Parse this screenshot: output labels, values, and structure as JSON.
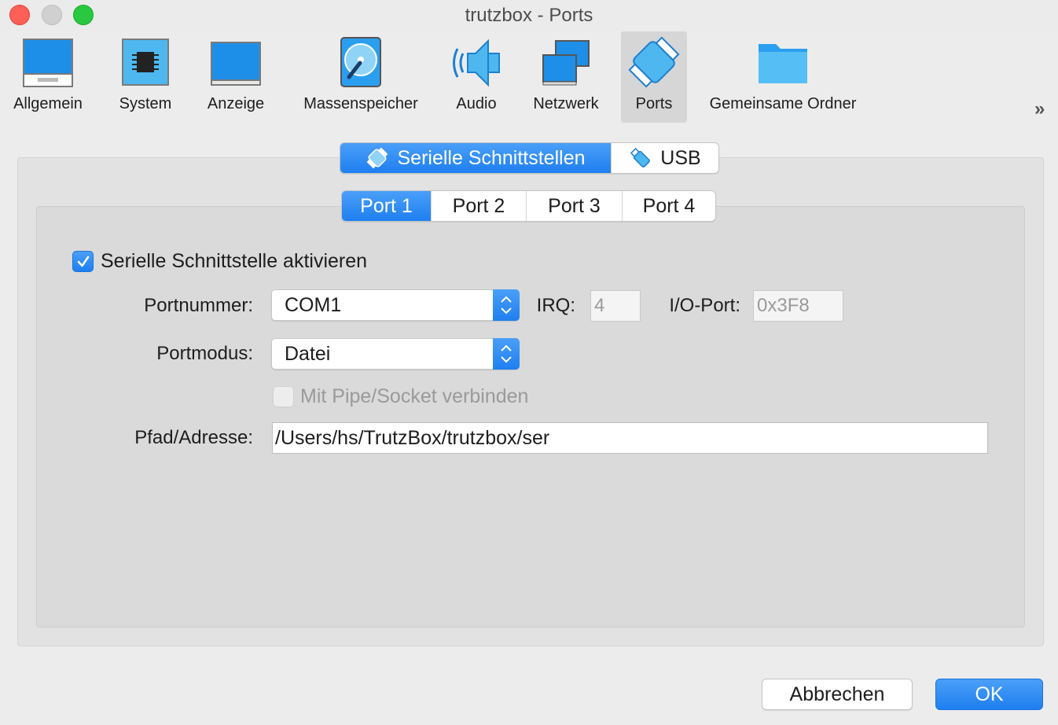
{
  "window": {
    "title": "trutzbox - Ports"
  },
  "toolbar": {
    "items": [
      {
        "label": "Allgemein",
        "icon": "monitor-general-icon"
      },
      {
        "label": "System",
        "icon": "chip-icon"
      },
      {
        "label": "Anzeige",
        "icon": "display-icon"
      },
      {
        "label": "Massenspeicher",
        "icon": "hard-disk-icon"
      },
      {
        "label": "Audio",
        "icon": "speaker-icon"
      },
      {
        "label": "Netzwerk",
        "icon": "network-icon"
      },
      {
        "label": "Ports",
        "icon": "serial-port-icon",
        "active": true
      },
      {
        "label": "Gemeinsame Ordner",
        "icon": "folder-icon"
      }
    ],
    "more": "»"
  },
  "main_tabs": [
    {
      "label": "Serielle Schnittstellen",
      "selected": true
    },
    {
      "label": "USB",
      "selected": false
    }
  ],
  "port_tabs": [
    {
      "label": "Port 1",
      "selected": true
    },
    {
      "label": "Port 2",
      "selected": false
    },
    {
      "label": "Port 3",
      "selected": false
    },
    {
      "label": "Port 4",
      "selected": false
    }
  ],
  "form": {
    "enable_label": "Serielle Schnittstelle aktivieren",
    "enable_checked": true,
    "portnummer_label": "Portnummer:",
    "portnummer_value": "COM1",
    "irq_label": "IRQ:",
    "irq_value": "4",
    "ioport_label": "I/O-Port:",
    "ioport_value": "0x3F8",
    "portmodus_label": "Portmodus:",
    "portmodus_value": "Datei",
    "pipe_label": "Mit Pipe/Socket verbinden",
    "pipe_checked": false,
    "path_label": "Pfad/Adresse:",
    "path_value": "/Users/hs/TrutzBox/trutzbox/ser"
  },
  "buttons": {
    "cancel": "Abbrechen",
    "ok": "OK"
  },
  "colors": {
    "accent": "#1f7ff0",
    "background": "#ececec"
  }
}
